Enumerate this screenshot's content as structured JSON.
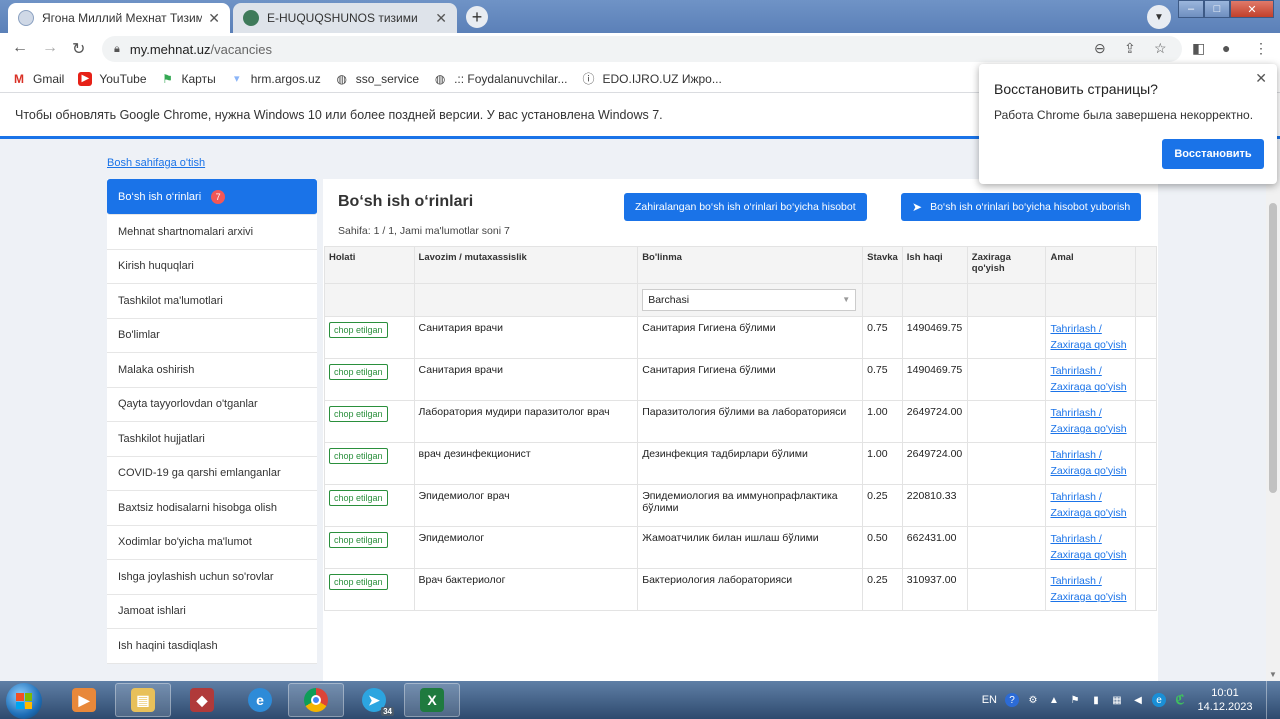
{
  "browser": {
    "tabs": [
      {
        "label": "Ягона Миллий Мехнат Тизими",
        "active": true
      },
      {
        "label": "E-HUQUQSHUNOS тизими",
        "active": false
      }
    ],
    "url_host": "my.mehnat.uz",
    "url_path": "/vacancies",
    "bookmarks": [
      {
        "label": "Gmail",
        "icon": "gmail-icon"
      },
      {
        "label": "YouTube",
        "icon": "youtube-icon"
      },
      {
        "label": "Карты",
        "icon": "maps-icon"
      },
      {
        "label": "hrm.argos.uz",
        "icon": "bookmark-icon"
      },
      {
        "label": "sso_service",
        "icon": "globe-icon"
      },
      {
        "label": ".:: Foydalanuvchilar...",
        "icon": "globe-icon"
      },
      {
        "label": "EDO.IJRO.UZ Ижро...",
        "icon": "info-icon"
      }
    ],
    "infobar": "Чтобы обновлять Google Chrome, нужна Windows 10 или более поздней версии. У вас установлена Windows 7."
  },
  "popup": {
    "title": "Восстановить страницы?",
    "text": "Работа Chrome была завершена некорректно.",
    "button": "Восстановить"
  },
  "page": {
    "home_link": "Bosh sahifaga o'tish",
    "sidebar": [
      {
        "label": "Bo‘sh ish o‘rinlari",
        "badge": "7",
        "active": true
      },
      {
        "label": "Mehnat shartnomalari arxivi"
      },
      {
        "label": "Kirish huquqlari"
      },
      {
        "label": "Tashkilot ma'lumotlari"
      },
      {
        "label": "Bo'limlar"
      },
      {
        "label": "Malaka oshirish"
      },
      {
        "label": "Qayta tayyorlovdan o'tganlar"
      },
      {
        "label": "Tashkilot hujjatlari"
      },
      {
        "label": "COVID-19 ga qarshi emlanganlar"
      },
      {
        "label": "Baxtsiz hodisalarni hisobga olish"
      },
      {
        "label": "Xodimlar bo'yicha ma'lumot"
      },
      {
        "label": "Ishga joylashish uchun so'rovlar"
      },
      {
        "label": "Jamoat ishlari"
      },
      {
        "label": "Ish haqini tasdiqlash"
      }
    ],
    "title": "Bo‘sh ish o‘rinlari",
    "page_info": "Sahifa: 1 / 1, Jami ma'lumotlar soni 7",
    "btn_report": "Zahiralangan bo‘sh ish o‘rinlari bo‘yicha hisobot",
    "btn_send": "Bo‘sh ish o‘rinlari bo‘yicha hisobot yuborish",
    "columns": [
      "Holati",
      "Lavozim / mutaxassislik",
      "Bo'linma",
      "Stavka",
      "Ish haqi",
      "Zaxiraga qo'yish",
      "Amal"
    ],
    "filter_select": "Barchasi",
    "rows": [
      {
        "status": "chop etilgan",
        "position": "Санитария врачи",
        "unit": "Санитария Гигиена бўлими",
        "rate": "0.75",
        "salary": "1490469.75",
        "action1": "Tahrirlash /",
        "action2": "Zaxiraga qo'yish"
      },
      {
        "status": "chop etilgan",
        "position": "Санитария врачи",
        "unit": "Санитария Гигиена бўлими",
        "rate": "0.75",
        "salary": "1490469.75",
        "action1": "Tahrirlash /",
        "action2": "Zaxiraga qo'yish"
      },
      {
        "status": "chop etilgan",
        "position": "Лаборатория мудири паразитолог врач",
        "unit": "Паразитология бўлими ва лабораторияси",
        "rate": "1.00",
        "salary": "2649724.00",
        "action1": "Tahrirlash /",
        "action2": "Zaxiraga qo'yish"
      },
      {
        "status": "chop etilgan",
        "position": "врач дезинфекционист",
        "unit": "Дезинфекция тадбирлари бўлими",
        "rate": "1.00",
        "salary": "2649724.00",
        "action1": "Tahrirlash /",
        "action2": "Zaxiraga qo'yish"
      },
      {
        "status": "chop etilgan",
        "position": "Эпидемиолог врач",
        "unit": "Эпидемиология ва иммунопрафлактика бўлими",
        "rate": "0.25",
        "salary": "220810.33",
        "action1": "Tahrirlash /",
        "action2": "Zaxiraga qo'yish"
      },
      {
        "status": "chop etilgan",
        "position": "Эпидемиолог",
        "unit": "Жамоатчилик билан ишлаш бўлими",
        "rate": "0.50",
        "salary": "662431.00",
        "action1": "Tahrirlash /",
        "action2": "Zaxiraga qo'yish"
      },
      {
        "status": "chop etilgan",
        "position": "Врач бактериолог",
        "unit": "Бактериология лабораторияси",
        "rate": "0.25",
        "salary": "310937.00",
        "action1": "Tahrirlash /",
        "action2": "Zaxiraga qo'yish"
      }
    ]
  },
  "taskbar": {
    "lang": "EN",
    "telegram_badge": "34",
    "time": "10:01",
    "date": "14.12.2023"
  },
  "colors": {
    "accent": "#1a73e8",
    "status_green": "#2a8f3c",
    "badge_red": "#f25757"
  }
}
